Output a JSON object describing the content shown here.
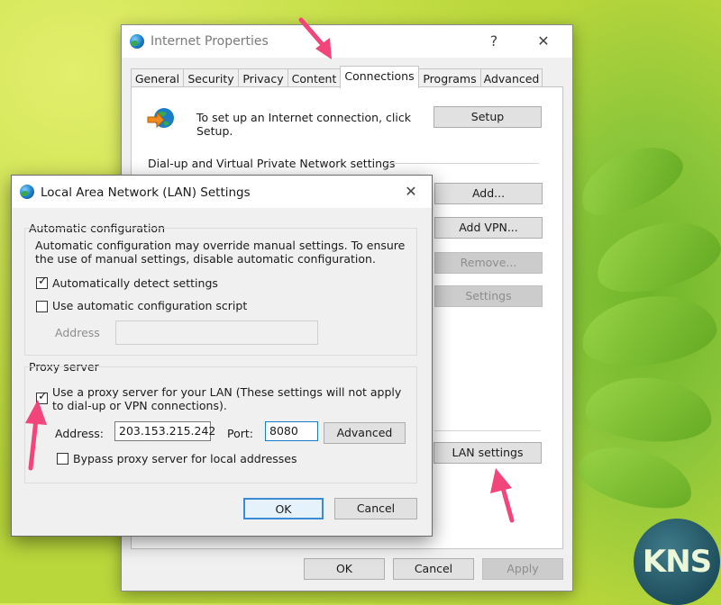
{
  "main_window": {
    "title": "Internet Properties",
    "help_glyph": "?",
    "close_glyph": "✕",
    "tabs": [
      {
        "label": "General"
      },
      {
        "label": "Security"
      },
      {
        "label": "Privacy"
      },
      {
        "label": "Content"
      },
      {
        "label": "Connections"
      },
      {
        "label": "Programs"
      },
      {
        "label": "Advanced"
      }
    ],
    "active_tab": "Connections",
    "setup_text": "To set up an Internet connection, click Setup.",
    "setup_button": "Setup",
    "dialup_section": "Dial-up and Virtual Private Network settings",
    "add_button": "Add...",
    "add_vpn_button": "Add VPN...",
    "remove_button": "Remove...",
    "settings_button": "Settings",
    "lan_settings_button": "LAN settings",
    "ok_button": "OK",
    "cancel_button": "Cancel",
    "apply_button": "Apply"
  },
  "lan_dialog": {
    "title": "Local Area Network (LAN) Settings",
    "close_glyph": "✕",
    "auto_config": {
      "label": "Automatic configuration",
      "description": "Automatic configuration may override manual settings.  To ensure the use of manual settings, disable automatic configuration.",
      "auto_detect_label": "Automatically detect settings",
      "auto_detect_checked": true,
      "use_script_label": "Use automatic configuration script",
      "use_script_checked": false,
      "address_label": "Address",
      "address_value": ""
    },
    "proxy": {
      "label": "Proxy server",
      "use_proxy_label": "Use a proxy server for your LAN (These settings will not apply to dial-up or VPN connections).",
      "use_proxy_checked": true,
      "address_label": "Address:",
      "address_value": "203.153.215.242",
      "port_label": "Port:",
      "port_value": "8080",
      "advanced_button": "Advanced",
      "bypass_label": "Bypass proxy server for local addresses",
      "bypass_checked": false
    },
    "ok_button": "OK",
    "cancel_button": "Cancel"
  },
  "watermark": "KNS",
  "icons": {
    "check": "✓",
    "window_icon": "globe-icon",
    "connection_icon": "globe-arrow-icon"
  },
  "colors": {
    "annotation_arrow": "#f2457c",
    "focus_blue": "#3a8ad8"
  }
}
